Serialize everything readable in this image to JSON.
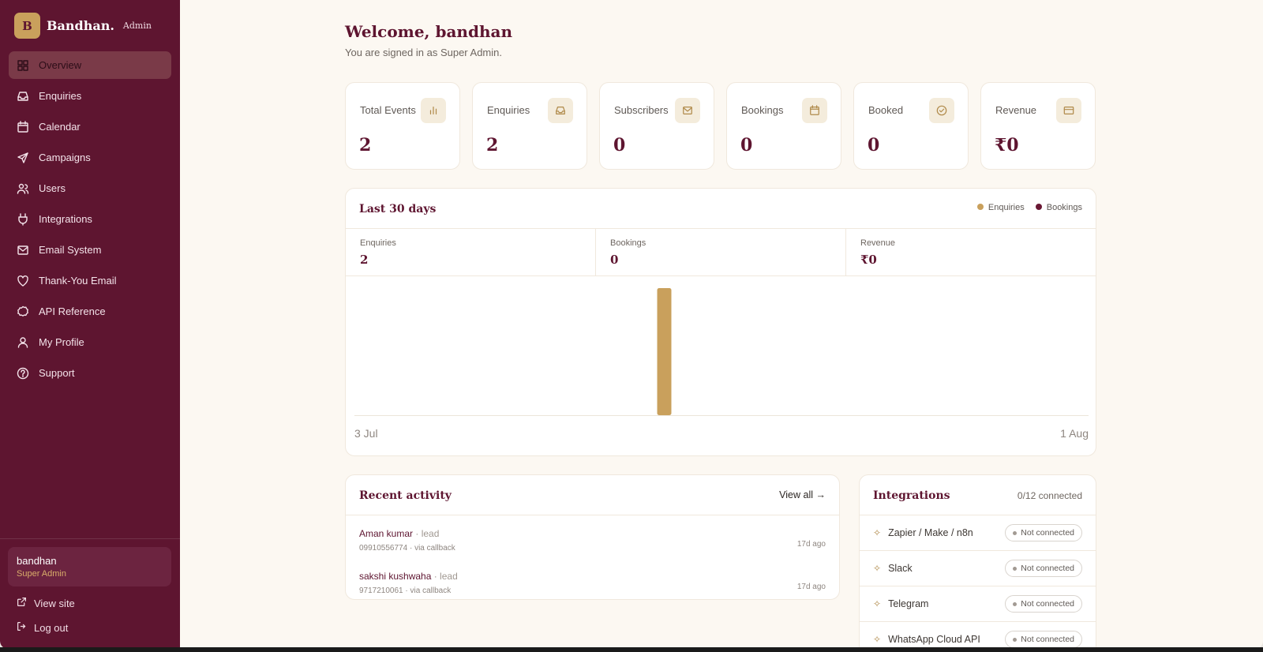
{
  "brand": {
    "badge": "B",
    "name": "Bandhan.",
    "sub": "Admin"
  },
  "nav": [
    {
      "label": "Overview",
      "icon": "grid-icon",
      "active": true
    },
    {
      "label": "Enquiries",
      "icon": "inbox-icon"
    },
    {
      "label": "Calendar",
      "icon": "calendar-icon"
    },
    {
      "label": "Campaigns",
      "icon": "send-icon"
    },
    {
      "label": "Users",
      "icon": "users-icon"
    },
    {
      "label": "Integrations",
      "icon": "plug-icon"
    },
    {
      "label": "Email System",
      "icon": "mail-icon"
    },
    {
      "label": "Thank-You Email",
      "icon": "heart-icon"
    },
    {
      "label": "API Reference",
      "icon": "gear-icon"
    },
    {
      "label": "My Profile",
      "icon": "user-icon"
    },
    {
      "label": "Support",
      "icon": "help-icon"
    }
  ],
  "user": {
    "name": "bandhan",
    "role": "Super Admin"
  },
  "footer": {
    "view_site": "View site",
    "logout": "Log out"
  },
  "header": {
    "welcome": "Welcome, bandhan",
    "signed_in": "You are signed in as Super Admin."
  },
  "stats": [
    {
      "label": "Total Events",
      "value": "2",
      "icon": "bar-chart-icon"
    },
    {
      "label": "Enquiries",
      "value": "2",
      "icon": "inbox-icon"
    },
    {
      "label": "Subscribers",
      "value": "0",
      "icon": "mail-icon"
    },
    {
      "label": "Bookings",
      "value": "0",
      "icon": "calendar-icon"
    },
    {
      "label": "Booked",
      "value": "0",
      "icon": "check-circle-icon"
    },
    {
      "label": "Revenue",
      "value": "₹0",
      "icon": "card-icon"
    }
  ],
  "period": {
    "title": "Last 30 days",
    "kpis": [
      {
        "label": "Enquiries",
        "value": "2"
      },
      {
        "label": "Bookings",
        "value": "0"
      },
      {
        "label": "Revenue",
        "value": "₹0"
      }
    ]
  },
  "colors": {
    "enquiries": "#c9a05c",
    "bookings": "#6a1834",
    "brand": "#5e1530"
  },
  "chart_data": {
    "type": "bar",
    "x_start": "3 Jul",
    "x_end": "1 Aug",
    "series": [
      {
        "name": "Enquiries",
        "color": "#c9a05c",
        "values": [
          0,
          0,
          0,
          0,
          0,
          0,
          0,
          0,
          0,
          0,
          0,
          0,
          2,
          0,
          0,
          0,
          0,
          0,
          0,
          0,
          0,
          0,
          0,
          0,
          0,
          0,
          0,
          0,
          0,
          0
        ]
      },
      {
        "name": "Bookings",
        "color": "#6a1834",
        "values": [
          0,
          0,
          0,
          0,
          0,
          0,
          0,
          0,
          0,
          0,
          0,
          0,
          0,
          0,
          0,
          0,
          0,
          0,
          0,
          0,
          0,
          0,
          0,
          0,
          0,
          0,
          0,
          0,
          0,
          0
        ]
      }
    ],
    "ymax": 2
  },
  "activity": {
    "title": "Recent activity",
    "view_all": "View all →",
    "items": [
      {
        "name": "Aman kumar",
        "type": " · lead",
        "meta": "09910556774 · via callback",
        "time": "17d ago"
      },
      {
        "name": "sakshi kushwaha",
        "type": " · lead",
        "meta": "9717210061 · via callback",
        "time": "17d ago"
      }
    ]
  },
  "integrations": {
    "title": "Integrations",
    "count": "0/12 connected",
    "items": [
      {
        "name": "Zapier / Make / n8n",
        "status": "Not connected"
      },
      {
        "name": "Slack",
        "status": "Not connected"
      },
      {
        "name": "Telegram",
        "status": "Not connected"
      },
      {
        "name": "WhatsApp Cloud API",
        "status": "Not connected"
      }
    ]
  }
}
